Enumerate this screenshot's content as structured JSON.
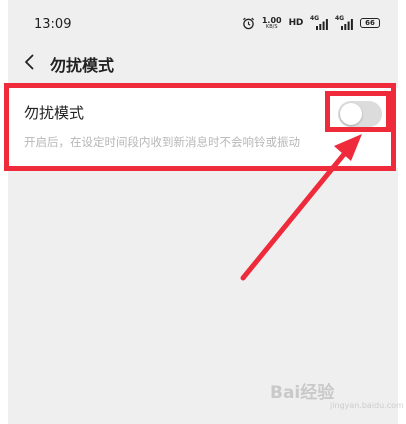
{
  "status_bar": {
    "time": "13:09",
    "speed_value": "1.00",
    "speed_unit": "KB/S",
    "hd_label": "HD",
    "network_1": "4G",
    "network_2": "4G",
    "battery_level": "66"
  },
  "header": {
    "title": "勿扰模式"
  },
  "setting": {
    "title": "勿扰模式",
    "description": "开启后，在设定时间段内收到新消息时不会响铃或振动",
    "toggle_on": false
  },
  "watermark": {
    "main": "Bai经验",
    "sub": "jingyan.baidu.com"
  },
  "colors": {
    "highlight": "#ee2a3b",
    "background": "#efefef",
    "toggle_off": "#dcdcdc"
  }
}
